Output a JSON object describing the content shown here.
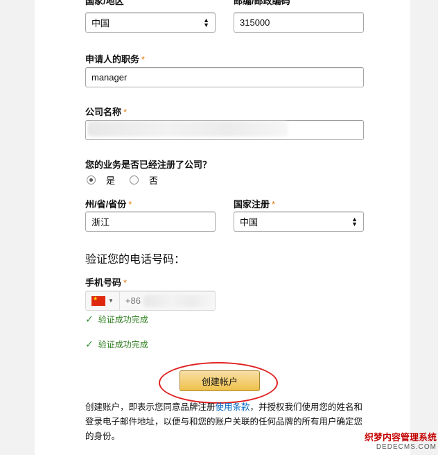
{
  "form": {
    "top_label_left": "国家/地区",
    "top_label_right": "邮编/邮政编码",
    "country_value": "中国",
    "postal_value": "315000",
    "title_label": "申请人的职务",
    "title_value": "manager",
    "company_label": "公司名称",
    "registered_question": "您的业务是否已经注册了公司？",
    "radio_yes": "是",
    "radio_no": "否",
    "state_label": "州/省/省份",
    "state_value": "浙江",
    "reg_country_label": "国家注册",
    "reg_country_value": "中国",
    "required_mark": "*"
  },
  "phone": {
    "section_title": "验证您的电话号码：",
    "mobile_label": "手机号码",
    "dial_code": "+86",
    "verified_1": "验证成功完成",
    "verified_2": "验证成功完成"
  },
  "submit": {
    "label": "创建帐户"
  },
  "legal": {
    "text_before": "创建账户，即表示您同意品牌注册",
    "link": "使用条款",
    "text_after": "，并授权我们使用您的姓名和登录电子邮件地址，以便与和您的账户关联的任何品牌的所有用户确定您的身份。"
  },
  "watermark": {
    "line1": "织梦内容管理系统",
    "line2": "DEDECMS.COM"
  },
  "colors": {
    "accent_required": "#e47911",
    "link": "#0066c0",
    "annotation": "#e02020",
    "success": "#2e7d1e"
  }
}
